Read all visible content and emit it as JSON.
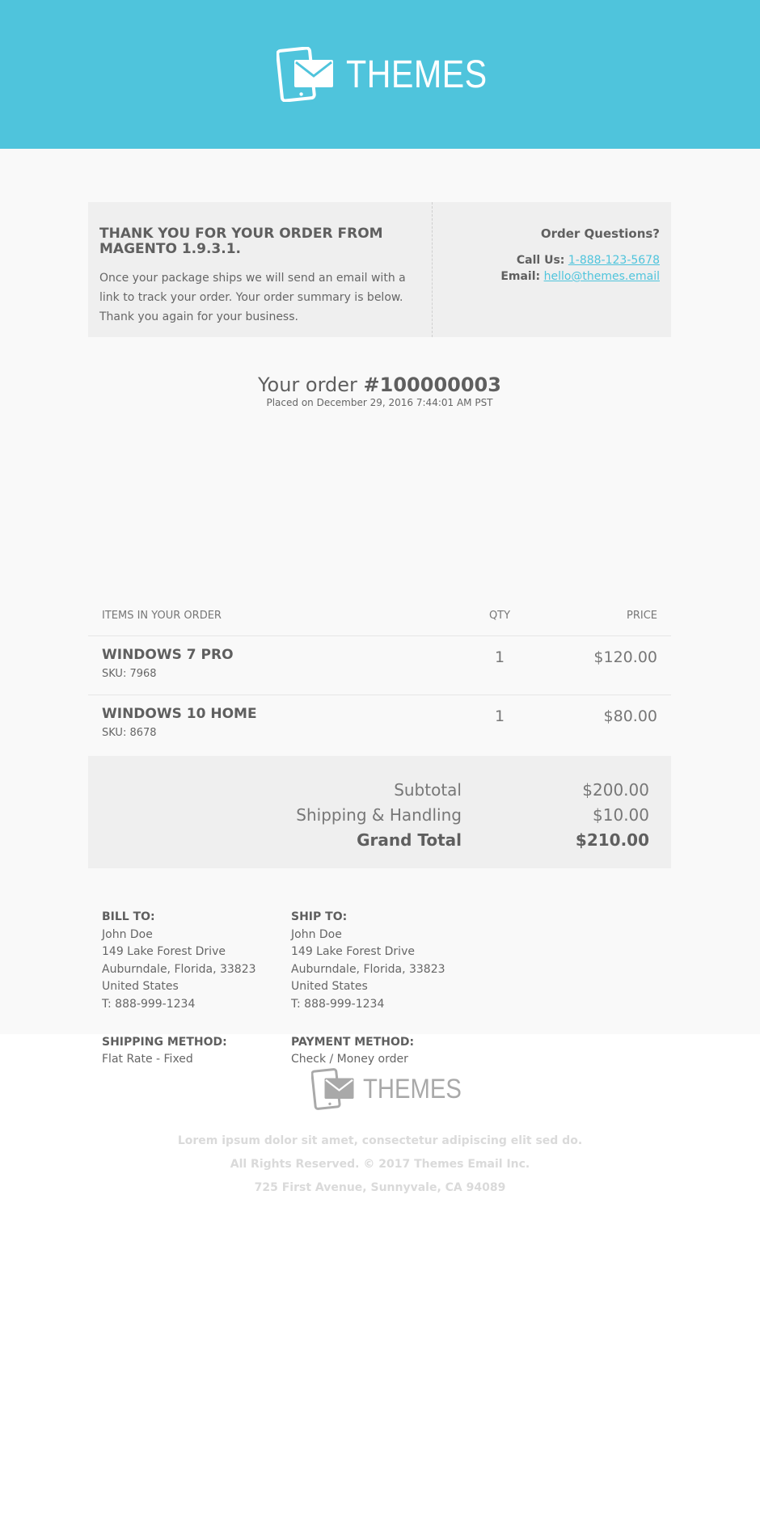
{
  "header": {
    "brand": "THEMES"
  },
  "thanks": {
    "title": "THANK YOU FOR YOUR ORDER FROM MAGENTO 1.9.3.1.",
    "body": "Once your package ships we will send an email with a link to track your order. Your order summary is below. Thank you again for your business.",
    "questions_title": "Order Questions?",
    "call_label": "Call Us:",
    "phone": "1-888-123-5678",
    "email_label": "Email:",
    "email": "hello@themes.email"
  },
  "order": {
    "prefix": "Your order",
    "number": "#100000003",
    "placed": "Placed on December 29, 2016 7:44:01 AM PST"
  },
  "items": {
    "headers": {
      "name": "ITEMS IN YOUR ORDER",
      "qty": "QTY",
      "price": "PRICE"
    },
    "rows": [
      {
        "name": "WINDOWS 7 PRO",
        "sku": "SKU: 7968",
        "qty": "1",
        "price": "$120.00"
      },
      {
        "name": "WINDOWS 10 HOME",
        "sku": "SKU: 8678",
        "qty": "1",
        "price": "$80.00"
      }
    ]
  },
  "totals": {
    "subtotal_label": "Subtotal",
    "subtotal": "$200.00",
    "shipping_label": "Shipping & Handling",
    "shipping": "$10.00",
    "grand_label": "Grand Total",
    "grand": "$210.00"
  },
  "billing": {
    "title": "BILL TO:",
    "name": "John Doe",
    "street": "149 Lake Forest Drive",
    "city": "Auburndale, Florida, 33823",
    "country": "United States",
    "phone": "T: 888-999-1234"
  },
  "shipping": {
    "title": "SHIP TO:",
    "name": "John Doe",
    "street": "149 Lake Forest Drive",
    "city": "Auburndale, Florida, 33823",
    "country": "United States",
    "phone": "T: 888-999-1234"
  },
  "methods": {
    "shipping_title": "SHIPPING METHOD:",
    "shipping_value": "Flat Rate - Fixed",
    "payment_title": "PAYMENT METHOD:",
    "payment_value": "Check / Money order"
  },
  "footer": {
    "brand": "THEMES",
    "line1": "Lorem ipsum dolor sit amet, consectetur adipiscing elit sed do.",
    "line2": "All Rights Reserved. © 2017 Themes Email Inc.",
    "line3": "725 First Avenue, Sunnyvale, CA 94089"
  },
  "colors": {
    "accent": "#4fc4dc",
    "panel": "#efefef",
    "background": "#f9f9f9"
  },
  "icons": {
    "logo": "tablet-envelope-icon"
  }
}
